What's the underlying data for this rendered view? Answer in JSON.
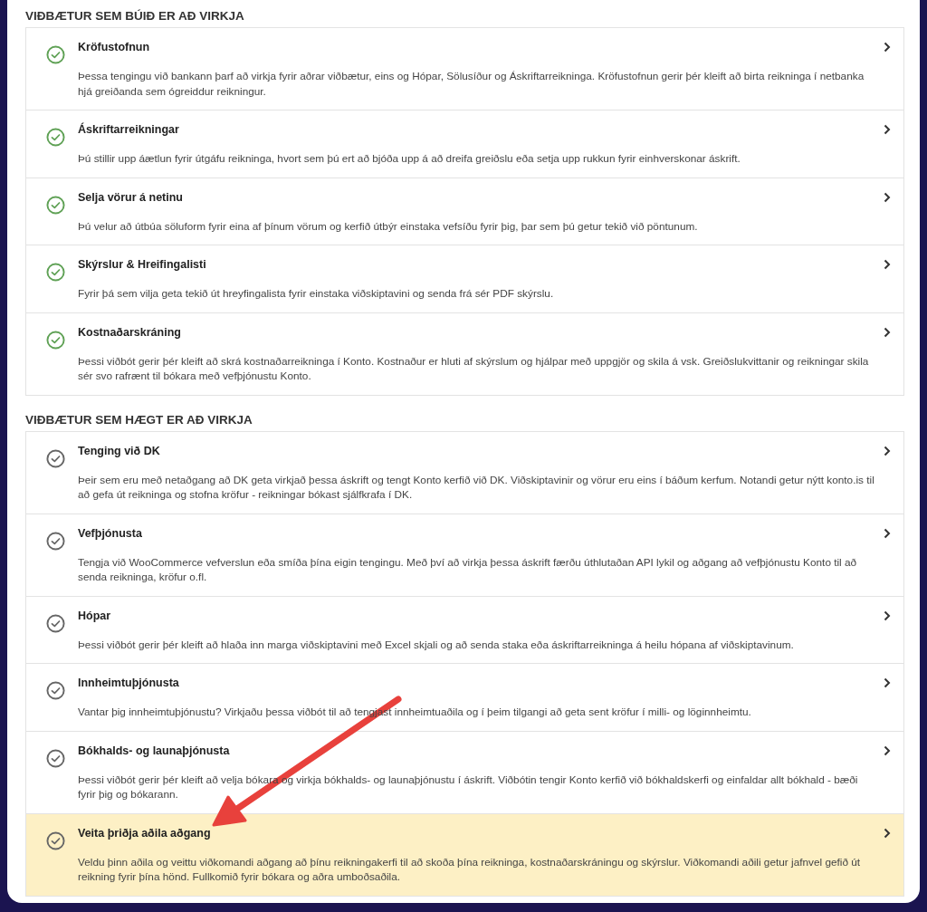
{
  "sections": [
    {
      "heading": "VIÐBÆTUR SEM BÚIÐ ER AÐ VIRKJA",
      "items": [
        {
          "title": "Kröfustofnun",
          "description": "Þessa tengingu við bankann þarf að virkja fyrir aðrar viðbætur, eins og Hópar, Sölusíður og Áskriftarreikninga. Kröfustofnun gerir þér kleift að birta reikninga í netbanka hjá greiðanda sem ógreiddur reikningur.",
          "enabled": true,
          "highlighted": false
        },
        {
          "title": "Áskriftarreikningar",
          "description": "Þú stillir upp áætlun fyrir útgáfu reikninga, hvort sem þú ert að bjóða upp á að dreifa greiðslu eða setja upp rukkun fyrir einhverskonar áskrift.",
          "enabled": true,
          "highlighted": false
        },
        {
          "title": "Selja vörur á netinu",
          "description": "Þú velur að útbúa söluform fyrir eina af þínum vörum og kerfið útbýr einstaka vefsíðu fyrir þig, þar sem þú getur tekið við pöntunum.",
          "enabled": true,
          "highlighted": false
        },
        {
          "title": "Skýrslur & Hreifingalisti",
          "description": "Fyrir þá sem vilja geta tekið út hreyfingalista fyrir einstaka viðskiptavini og senda frá sér PDF skýrslu.",
          "enabled": true,
          "highlighted": false
        },
        {
          "title": "Kostnaðarskráning",
          "description": "Þessi viðbót gerir þér kleift að skrá kostnaðarreikninga í Konto. Kostnaður er hluti af skýrslum og hjálpar með uppgjör og skila á vsk. Greiðslukvittanir og reikningar skila sér svo rafrænt til bókara með vefþjónustu Konto.",
          "enabled": true,
          "highlighted": false
        }
      ]
    },
    {
      "heading": "VIÐBÆTUR SEM HÆGT ER AÐ VIRKJA",
      "items": [
        {
          "title": "Tenging við DK",
          "description": "Þeir sem eru með netaðgang að DK geta virkjað þessa áskrift og tengt Konto kerfið við DK. Viðskiptavinir og vörur eru eins í báðum kerfum. Notandi getur nýtt konto.is til að gefa út reikninga og stofna kröfur - reikningar bókast sjálfkrafa í DK.",
          "enabled": false,
          "highlighted": false
        },
        {
          "title": "Vefþjónusta",
          "description": "Tengja við WooCommerce vefverslun eða smíða þína eigin tengingu. Með því að virkja þessa áskrift færðu úthlutaðan API lykil og aðgang að vefþjónustu Konto til að senda reikninga, kröfur o.fl.",
          "enabled": false,
          "highlighted": false
        },
        {
          "title": "Hópar",
          "description": "Þessi viðbót gerir þér kleift að hlaða inn marga viðskiptavini með Excel skjali og að senda staka eða áskriftarreikninga á heilu hópana af viðskiptavinum.",
          "enabled": false,
          "highlighted": false
        },
        {
          "title": "Innheimtuþjónusta",
          "description": "Vantar þig innheimtuþjónustu? Virkjaðu þessa viðbót til að tengjast innheimtuaðila og í þeim tilgangi að geta sent kröfur í milli- og löginnheimtu.",
          "enabled": false,
          "highlighted": false
        },
        {
          "title": "Bókhalds- og launaþjónusta",
          "description": "Þessi viðbót gerir þér kleift að velja bókara og virkja bókhalds- og launaþjónustu í áskrift. Viðbótin tengir Konto kerfið við bókhaldskerfi og einfaldar allt bókhald - bæði fyrir þig og bókarann.",
          "enabled": false,
          "highlighted": false
        },
        {
          "title": "Veita þriðja aðila aðgang",
          "description": "Veldu þinn aðila og veittu viðkomandi aðgang að þínu reikningakerfi til að skoða þína reikninga, kostnaðarskráningu og skýrslur. Viðkomandi aðili getur jafnvel gefið út reikning fyrir þína hönd. Fullkomið fyrir bókara og aðra umboðsaðila.",
          "enabled": false,
          "highlighted": true
        }
      ]
    }
  ]
}
